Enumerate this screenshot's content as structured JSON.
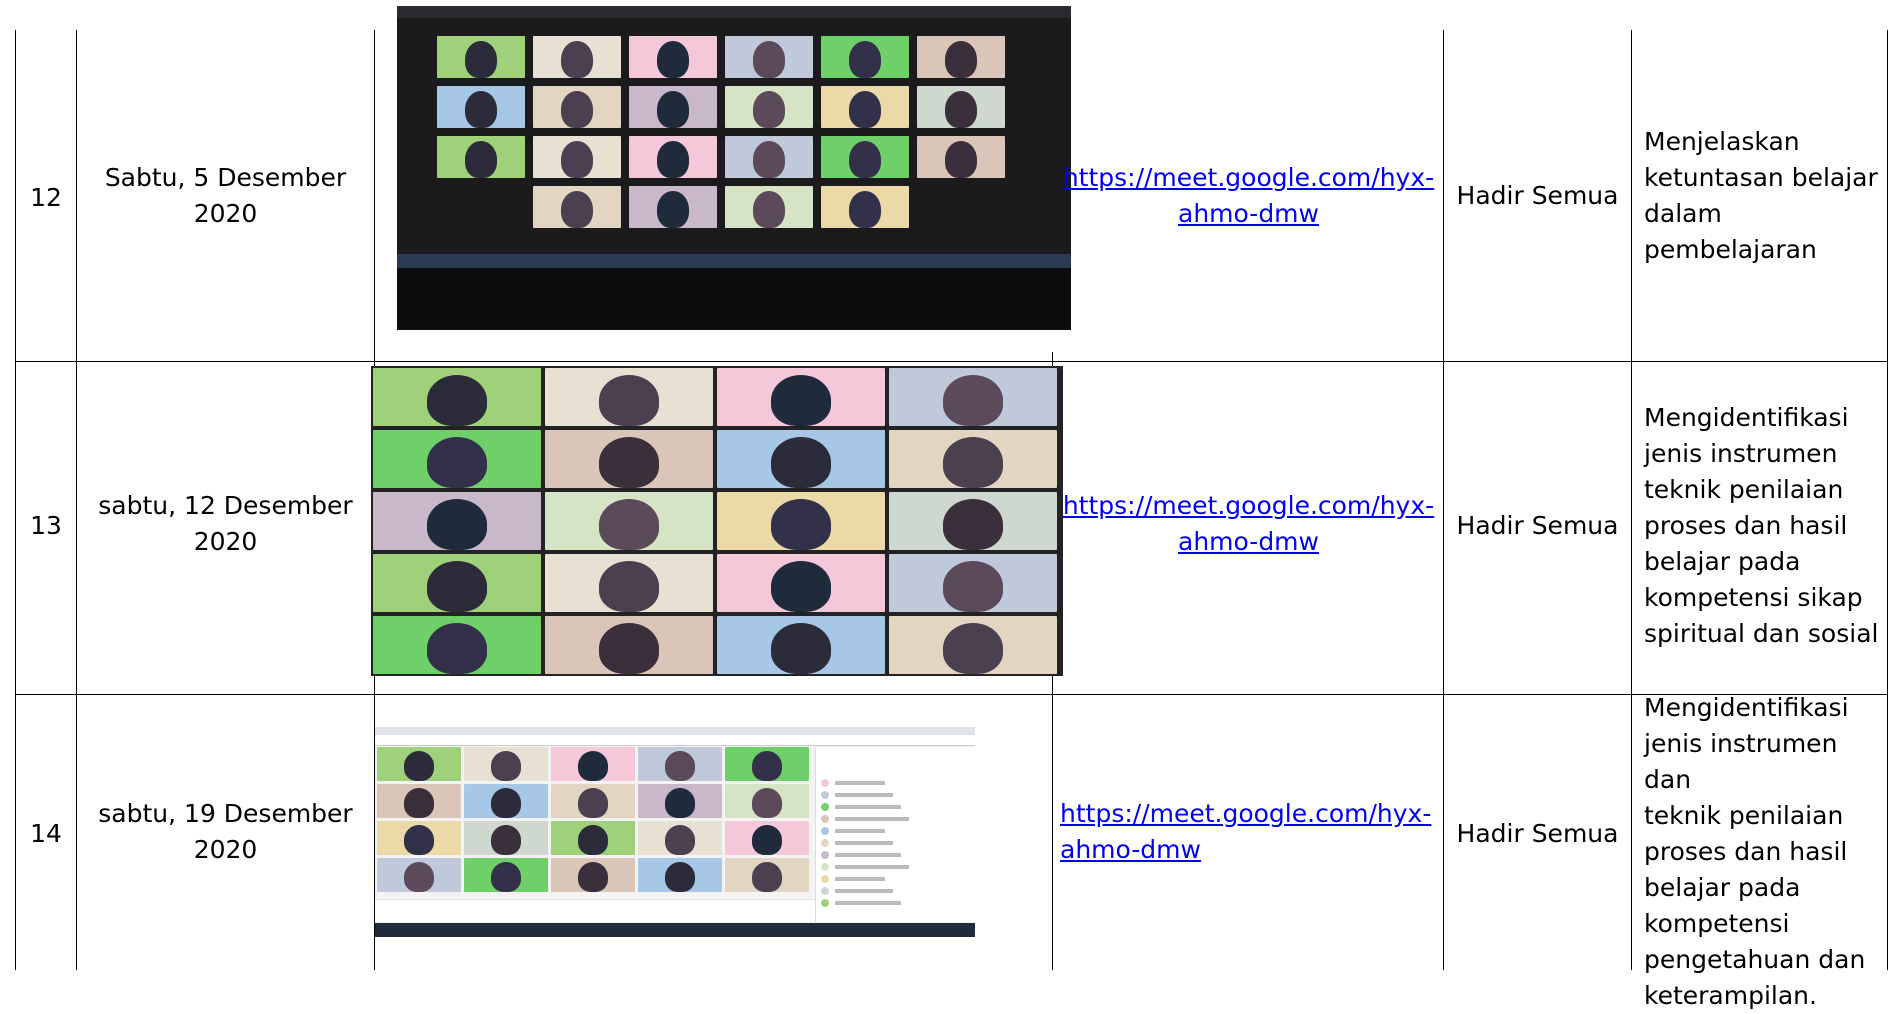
{
  "rows": [
    {
      "no": "12",
      "date_line1": "Sabtu, 5 Desember",
      "date_line2": "2020",
      "link_line1": "https://meet.google.com/hyx-",
      "link_line2": "ahmo-dmw",
      "attendance": "Hadir Semua",
      "activity_lines": [
        "Menjelaskan",
        "ketuntasan belajar",
        "dalam",
        "pembelajaran"
      ],
      "screenshot_icon": "video-call-screenshot-icon"
    },
    {
      "no": "13",
      "date_line1": "sabtu, 12 Desember",
      "date_line2": "2020",
      "link_line1": "https://meet.google.com/hyx-",
      "link_line2": "ahmo-dmw",
      "attendance": "Hadir Semua",
      "activity_lines": [
        "Mengidentifikasi",
        "jenis instrumen",
        "teknik penilaian",
        "proses dan hasil",
        "belajar pada",
        "kompetensi sikap",
        "spiritual dan sosial"
      ],
      "screenshot_icon": "video-call-screenshot-icon"
    },
    {
      "no": "14",
      "date_line1": "sabtu, 19 Desember",
      "date_line2": "2020",
      "link_line1": "https://meet.google.com/hyx-",
      "link_line2": "ahmo-dmw",
      "attendance": "Hadir Semua",
      "activity_lines": [
        "Mengidentifikasi",
        "jenis instrumen dan",
        "teknik penilaian",
        "proses dan hasil",
        "belajar pada",
        "kompetensi",
        "pengetahuan dan",
        "keterampilan."
      ],
      "screenshot_icon": "video-call-screenshot-icon"
    }
  ],
  "colors": {
    "link": "#0000ee",
    "grid": "#000000",
    "call_background": "#1b1b1d"
  }
}
